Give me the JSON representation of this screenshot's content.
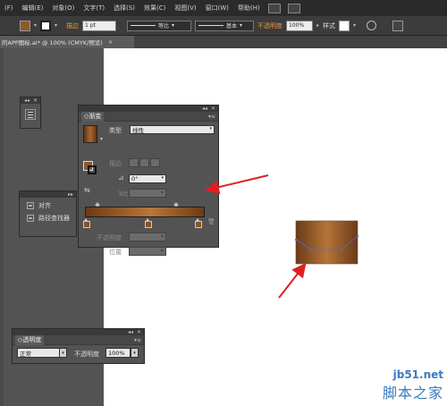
{
  "menu": {
    "items": [
      "(F)",
      "编辑(E)",
      "对象(O)",
      "文字(T)",
      "选择(S)",
      "效果(C)",
      "视图(V)",
      "窗口(W)",
      "帮助(H)"
    ]
  },
  "control_bar": {
    "fill_color": "#8b5a2b",
    "stroke_label": "描边",
    "stroke_weight": "1 pt",
    "profile_label": "等比",
    "brush_label": "基本",
    "opacity_label": "不透明度",
    "opacity_value": "100%",
    "style_label": "样式"
  },
  "document_tab": {
    "title": "的APP图标.ai* @ 100% (CMYK/预览)",
    "close": "×"
  },
  "gradient_panel": {
    "title": "渐变",
    "collapse": "◂◂",
    "close": "✕",
    "menu": "▾≡",
    "type_label": "类型",
    "type_value": "线性",
    "stroke_label": "描边",
    "angle_value": "0°",
    "ratio_label": "3比",
    "opacity_label": "不透明度",
    "location_label": "位置",
    "stops_count": 3,
    "colors": {
      "stop_dark": "#6b3a17",
      "stop_light": "#b9773a"
    }
  },
  "align_panel": {
    "collapse": "▸▸",
    "close": "✕",
    "items": [
      "对齐",
      "路径查找器"
    ]
  },
  "transparency_panel": {
    "title": "透明度",
    "collapse": "◂◂",
    "close": "✕",
    "menu": "▾≡",
    "blend_mode": "正常",
    "opacity_label": "不透明度",
    "opacity_value": "100%"
  },
  "watermark": {
    "site": "jb51.net",
    "brand": "脚本之家"
  },
  "annotation_color": "#e02020"
}
